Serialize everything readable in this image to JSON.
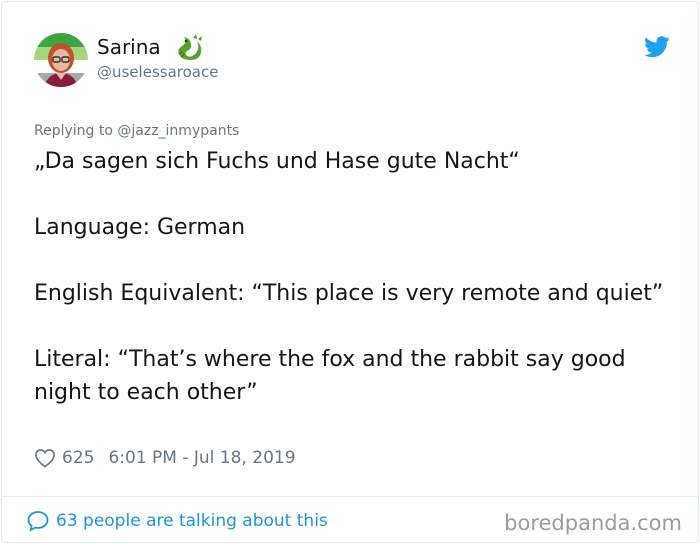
{
  "header": {
    "name": "Sarina",
    "handle": "@uselessaroace",
    "dragon_icon": "dragon-emoji-icon",
    "brand_icon": "twitter-bird-icon"
  },
  "tweet": {
    "replying_to": "Replying to @jazz_inmypants",
    "paragraphs": [
      "„Da sagen sich Fuchs und Hase gute Nacht“",
      "Language: German",
      "English Equivalent: “This place is very remote and quiet”",
      "Literal: “That’s where the fox and the rabbit say good night to each other”"
    ],
    "likes": "625",
    "timestamp": "6:01 PM - Jul 18, 2019"
  },
  "footer": {
    "talking": "63 people are talking about this",
    "brand": "boredpanda.com"
  },
  "colors": {
    "accent": "#1b95e0",
    "muted": "#657786",
    "text": "#14171a"
  }
}
